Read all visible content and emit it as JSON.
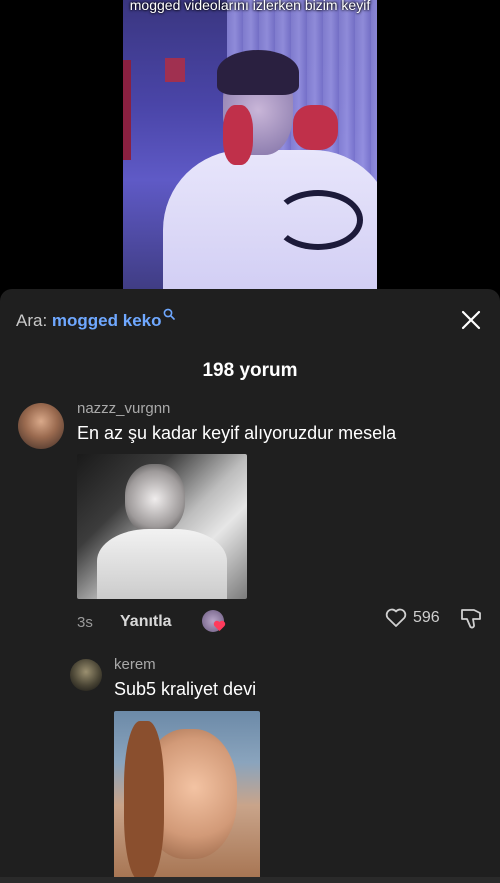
{
  "video": {
    "caption": "mogged videolarını izlerken bizim keyif"
  },
  "sheet": {
    "search_prefix": "Ara: ",
    "search_query": "mogged keko",
    "comment_count": "198 yorum"
  },
  "comments": [
    {
      "username": "nazzz_vurgnn",
      "text": "En az şu kadar keyif alıyoruzdur mesela",
      "time": "3s",
      "reply_label": "Yanıtla",
      "likes": "596"
    },
    {
      "username": "kerem",
      "text": "Sub5 kraliyet devi"
    }
  ],
  "colors": {
    "sheet_bg": "#1f1f1f",
    "search_accent": "#6fa8ff",
    "username": "#a9a9a9"
  },
  "icons": [
    "search-icon",
    "close-icon",
    "heart-icon",
    "dislike-icon"
  ]
}
